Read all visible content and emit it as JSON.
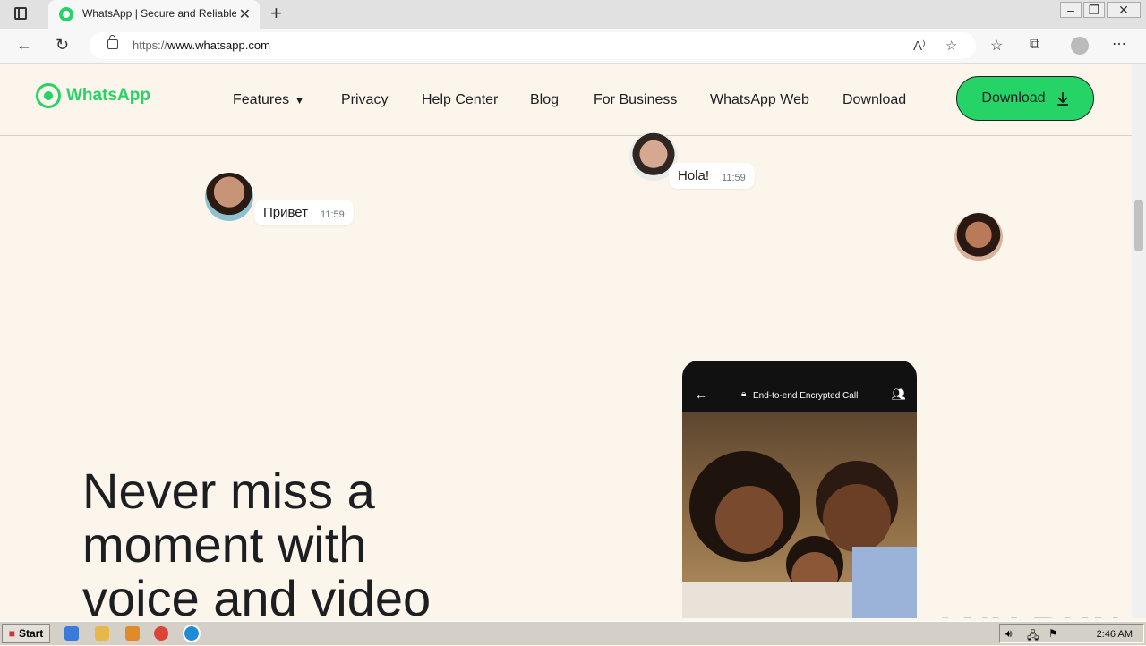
{
  "browser": {
    "tab_title": "WhatsApp | Secure and Reliable",
    "tab_close": "✕",
    "new_tab": "+",
    "url_scheme": "https://",
    "url_host": "www.whatsapp.com",
    "back": "←",
    "refresh": "↻",
    "read_aloud": "A⁾",
    "add_favorite": "☆",
    "favorites": "☆",
    "collections": "⧉",
    "more": "⋯"
  },
  "site": {
    "logo_text": "WhatsApp",
    "nav": {
      "features": "Features",
      "privacy": "Privacy",
      "help_center": "Help Center",
      "blog": "Blog",
      "for_business": "For Business",
      "whatsapp_web": "WhatsApp Web",
      "download": "Download"
    },
    "cta_label": "Download",
    "cta_icon": "download-icon"
  },
  "bubbles": {
    "privet_text": "Привет",
    "privet_time": "11:59",
    "hola_text": "Hola!",
    "hola_time": "11:59"
  },
  "phone": {
    "header": "End-to-end Encrypted Call"
  },
  "hero": {
    "line1": "Never miss a",
    "line2": "moment with",
    "line3": "voice and video"
  },
  "watermark": "ANY RUN",
  "taskbar": {
    "start": "Start",
    "time": "2:46 AM"
  },
  "colors": {
    "brand": "#25d366",
    "page_bg": "#fcf5eb",
    "text": "#1c1e21"
  }
}
